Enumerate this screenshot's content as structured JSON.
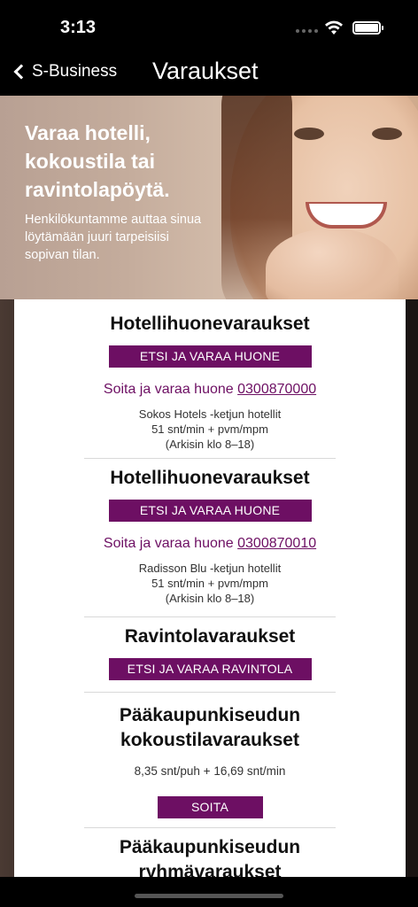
{
  "status_bar": {
    "time": "3:13"
  },
  "nav": {
    "back_label": "S-Business",
    "title": "Varaukset"
  },
  "hero": {
    "heading": "Varaa hotelli, kokoustila tai ravintolapöytä.",
    "text": "Henkilökuntamme auttaa sinua löytämään juuri tarpeisiisi sopivan tilan."
  },
  "sections": [
    {
      "title": "Hotellihuonevaraukset",
      "button": "ETSI JA VARAA HUONE",
      "call_prefix": "Soita ja varaa huone",
      "phone": "0300870000",
      "info": [
        "Sokos Hotels -ketjun hotellit",
        "51 snt/min + pvm/mpm",
        "(Arkisin klo 8–18)"
      ]
    },
    {
      "title": "Hotellihuonevaraukset",
      "button": "ETSI JA VARAA HUONE",
      "call_prefix": "Soita ja varaa huone",
      "phone": "0300870010",
      "info": [
        "Radisson Blu -ketjun hotellit",
        "51 snt/min + pvm/mpm",
        "(Arkisin klo 8–18)"
      ]
    },
    {
      "title": "Ravintolavaraukset",
      "button": "ETSI JA VARAA RAVINTOLA"
    },
    {
      "title_lines": [
        "Pääkaupunkiseudun",
        "kokoustilavaraukset"
      ],
      "price": "8,35 snt/puh + 16,69 snt/min",
      "button": "SOITA"
    },
    {
      "title_lines": [
        "Pääkaupunkiseudun",
        "ryhmävaraukset"
      ]
    }
  ],
  "colors": {
    "accent": "#6d0f63",
    "background": "#000000",
    "card": "#ffffff"
  }
}
